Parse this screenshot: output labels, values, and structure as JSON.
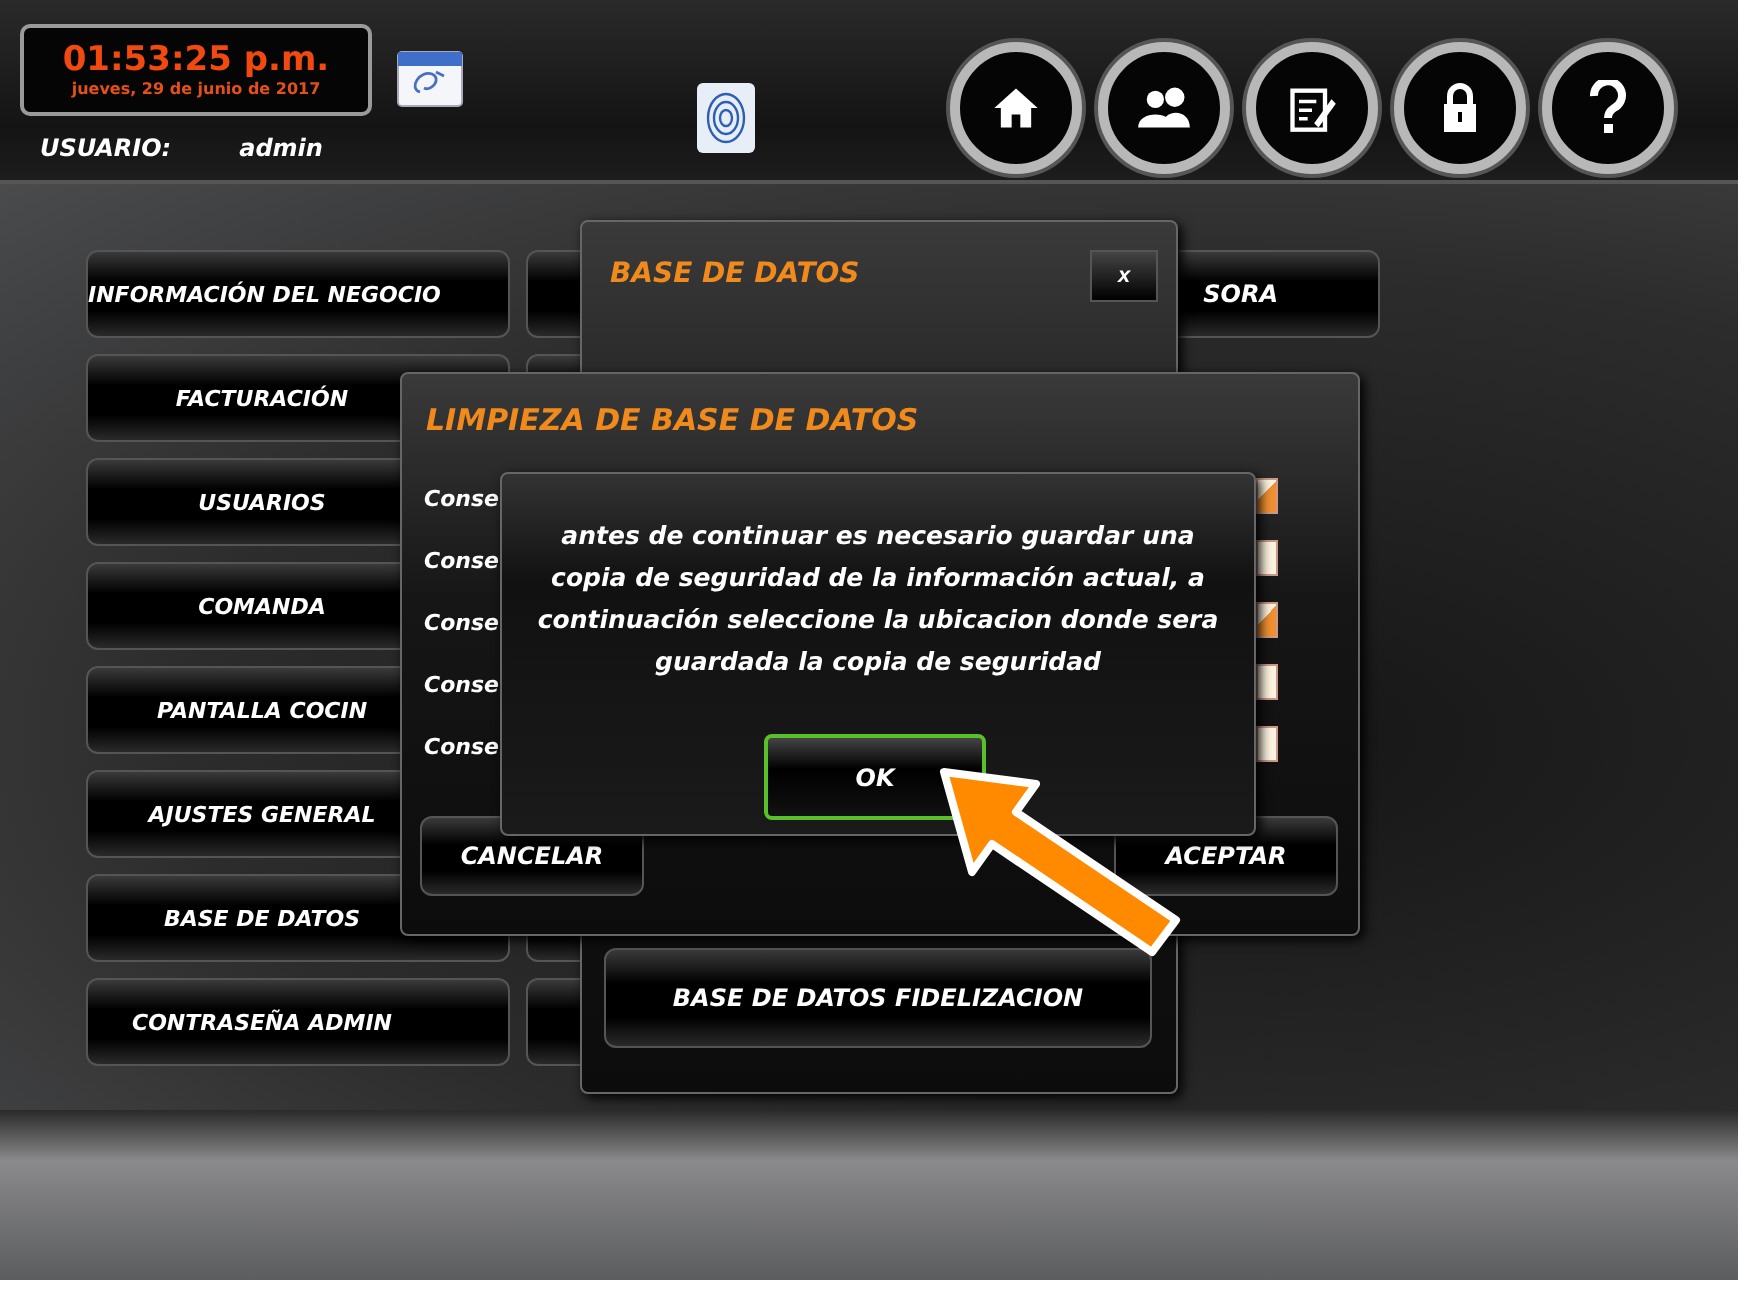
{
  "header": {
    "time": "01:53:25 p.m.",
    "date": "jueves, 29 de junio de 2017",
    "user_label": "USUARIO:",
    "user_name": "admin"
  },
  "menu": [
    "INFORMACIÓN DEL NEGOCIO",
    "FACTURACIÓN",
    "USUARIOS",
    "COMANDA",
    "PANTALLA COCIN",
    "AJUSTES GENERAL",
    "BASE DE DATOS",
    "CONTRASEÑA ADMIN"
  ],
  "right_menu": [
    "SORA"
  ],
  "database_dialog": {
    "title": "BASE DE DATOS",
    "close": "x",
    "buttons": [
      "BASE DE DATOS FIDELIZACION"
    ]
  },
  "cleanup_dialog": {
    "title": "LIMPIEZA DE BASE DE DATOS",
    "options": [
      {
        "label": "Conse",
        "checked": true
      },
      {
        "label": "Conse",
        "checked": false
      },
      {
        "label": "Conse",
        "checked": true
      },
      {
        "label": "Conse",
        "checked": false
      },
      {
        "label": "Conse",
        "checked": false
      }
    ],
    "cancel": "CANCELAR",
    "accept": "ACEPTAR"
  },
  "message_dialog": {
    "message": "antes de continuar es necesario guardar una copia de seguridad de la información actual, a continuación seleccione la ubicacion donde sera guardada la copia de seguridad",
    "ok": "OK"
  }
}
